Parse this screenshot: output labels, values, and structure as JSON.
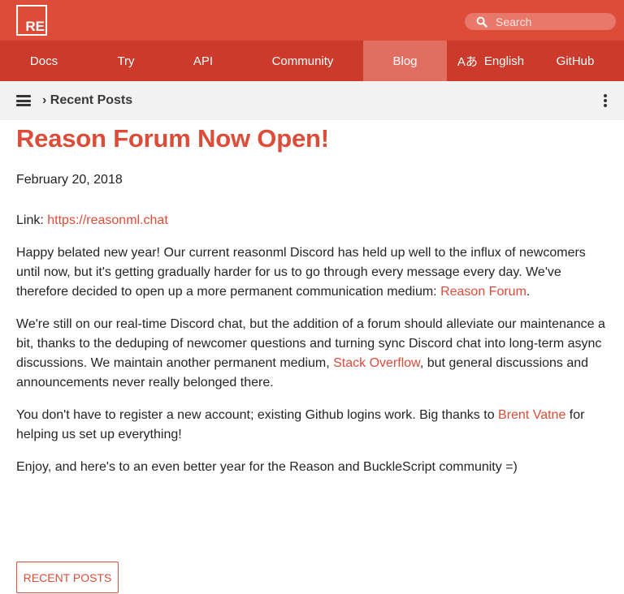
{
  "brand": {
    "logo_text": "RE",
    "accent": "#dd4c39",
    "nav_bg": "#cb3a2a",
    "active_bg": "#e16f61"
  },
  "search": {
    "placeholder": "Search",
    "icon": "search-icon"
  },
  "nav": {
    "items": [
      {
        "label": "Docs"
      },
      {
        "label": "Try"
      },
      {
        "label": "API"
      },
      {
        "label": "Community"
      },
      {
        "label": "Blog",
        "active": true
      },
      {
        "label": "English",
        "icon": "translate-icon",
        "icon_glyph": "Aあ"
      },
      {
        "label": "GitHub"
      }
    ]
  },
  "subbar": {
    "breadcrumb": "› Recent Posts",
    "menu_icon": "hamburger-icon",
    "more_icon": "kebab-menu-icon"
  },
  "post": {
    "title": "Reason Forum Now Open!",
    "date": "February 20, 2018",
    "p1": {
      "prefix": "Link: ",
      "link": "https://reasonml.chat"
    },
    "p2": {
      "text": "Happy belated new year! Our current reasonml Discord has held up well to the influx of newcomers until now, but it's getting gradually harder for us to go through every message every day. We've therefore decided to open up a more permanent communication medium: ",
      "link": "Reason Forum",
      "suffix": "."
    },
    "p3": {
      "text": "We're still on our real-time Discord chat, but the addition of a forum should alleviate our maintenance a bit, thanks to the deduping of newcomer questions and turning sync Discord chat into long-term async discussions. We maintain another permanent medium, ",
      "link": "Stack Overflow",
      "suffix": ", but general discussions and announcements never really belonged there."
    },
    "p4": {
      "text": "You don't have to register a new account; existing Github logins work. Big thanks to ",
      "link": "Brent Vatne",
      "suffix": " for helping us set up everything!"
    },
    "p5": {
      "text": "Enjoy, and here's to an even better year for the Reason and BuckleScript community =)"
    }
  },
  "footer": {
    "recent_posts_label": "RECENT POSTS"
  }
}
